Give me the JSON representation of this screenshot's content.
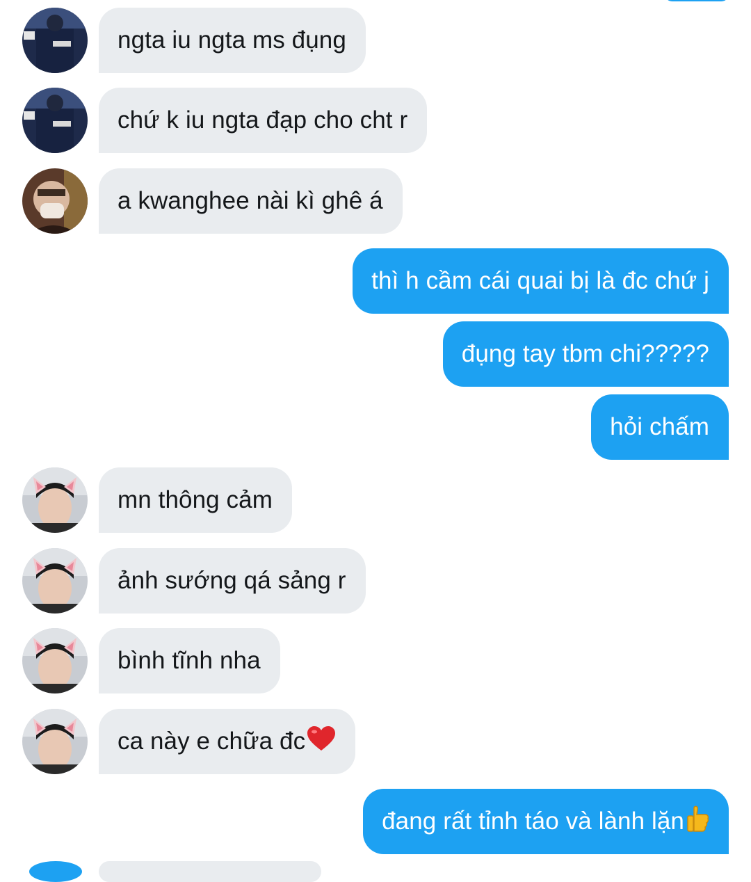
{
  "conversation": {
    "messages": [
      {
        "direction": "in",
        "avatar": "rascal-jacket-avatar",
        "text": "ngta iu ngta ms đụng"
      },
      {
        "direction": "in",
        "avatar": "rascal-jacket-avatar",
        "text": "chứ k iu ngta đạp cho cht r"
      },
      {
        "direction": "in",
        "avatar": "masked-person-avatar",
        "text": "a kwanghee nài kì ghê á"
      },
      {
        "direction": "out",
        "text": "thì h cầm cái quai bị là đc chứ j"
      },
      {
        "direction": "out",
        "text": "đụng tay tbm chi?????"
      },
      {
        "direction": "out",
        "text": "hỏi chấm"
      },
      {
        "direction": "in",
        "avatar": "cat-ears-avatar",
        "text": "mn thông cảm"
      },
      {
        "direction": "in",
        "avatar": "cat-ears-avatar",
        "text": "ảnh sướng qá sảng r"
      },
      {
        "direction": "in",
        "avatar": "cat-ears-avatar",
        "text": "bình tĩnh nha"
      },
      {
        "direction": "in",
        "avatar": "cat-ears-avatar",
        "text": "ca này e chữa đc",
        "emoji": "heart-emoji-icon"
      },
      {
        "direction": "out",
        "text": "đang rất tỉnh táo và lành lặn",
        "emoji": "thumbs-up-emoji-icon"
      }
    ]
  },
  "colors": {
    "incoming_bubble": "#e9ecef",
    "outgoing_bubble": "#1da1f2",
    "incoming_text": "#14171a",
    "outgoing_text": "#ffffff",
    "heart": "#e0262c",
    "thumbs_up": "#f5b81c"
  }
}
